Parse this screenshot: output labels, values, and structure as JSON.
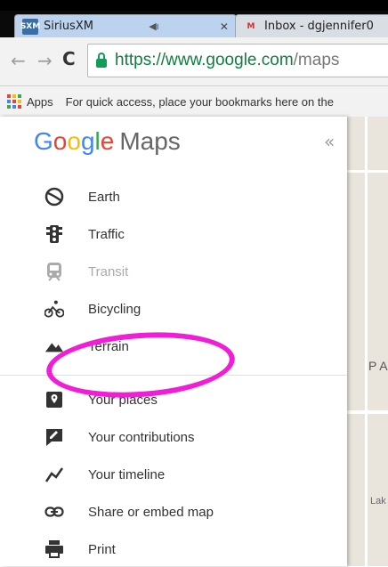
{
  "browser": {
    "tabs": [
      {
        "title": "SiriusXM",
        "favicon": "sxm-icon",
        "favicon_text": "SXM",
        "muted_icon": "speaker-muted-icon"
      },
      {
        "title": "Inbox - dgjennifer0",
        "favicon": "gmail-icon",
        "favicon_text": "M"
      }
    ],
    "url_secure": "https://www.google.com",
    "url_rest": "/maps",
    "bookmarks_apps_label": "Apps",
    "bookmarks_hint": "For quick access, place your bookmarks here on the"
  },
  "panel": {
    "brand_letters": [
      "G",
      "o",
      "o",
      "g",
      "l",
      "e"
    ],
    "brand_suffix": "Maps",
    "collapse_glyph": "«",
    "layers": [
      {
        "label": "Earth",
        "icon": "earth-icon",
        "enabled": true
      },
      {
        "label": "Traffic",
        "icon": "traffic-light-icon",
        "enabled": true
      },
      {
        "label": "Transit",
        "icon": "transit-icon",
        "enabled": false
      },
      {
        "label": "Bicycling",
        "icon": "bicycle-icon",
        "enabled": true
      },
      {
        "label": "Terrain",
        "icon": "terrain-icon",
        "enabled": true
      }
    ],
    "actions": [
      {
        "label": "Your places",
        "icon": "place-pin-icon"
      },
      {
        "label": "Your contributions",
        "icon": "edit-icon"
      },
      {
        "label": "Your timeline",
        "icon": "timeline-icon"
      },
      {
        "label": "Share or embed map",
        "icon": "link-icon"
      },
      {
        "label": "Print",
        "icon": "print-icon"
      }
    ]
  },
  "map": {
    "label_pa": "P A",
    "label_lak": "Lak"
  },
  "annotation": {
    "highlight_color": "#f21dd7"
  }
}
